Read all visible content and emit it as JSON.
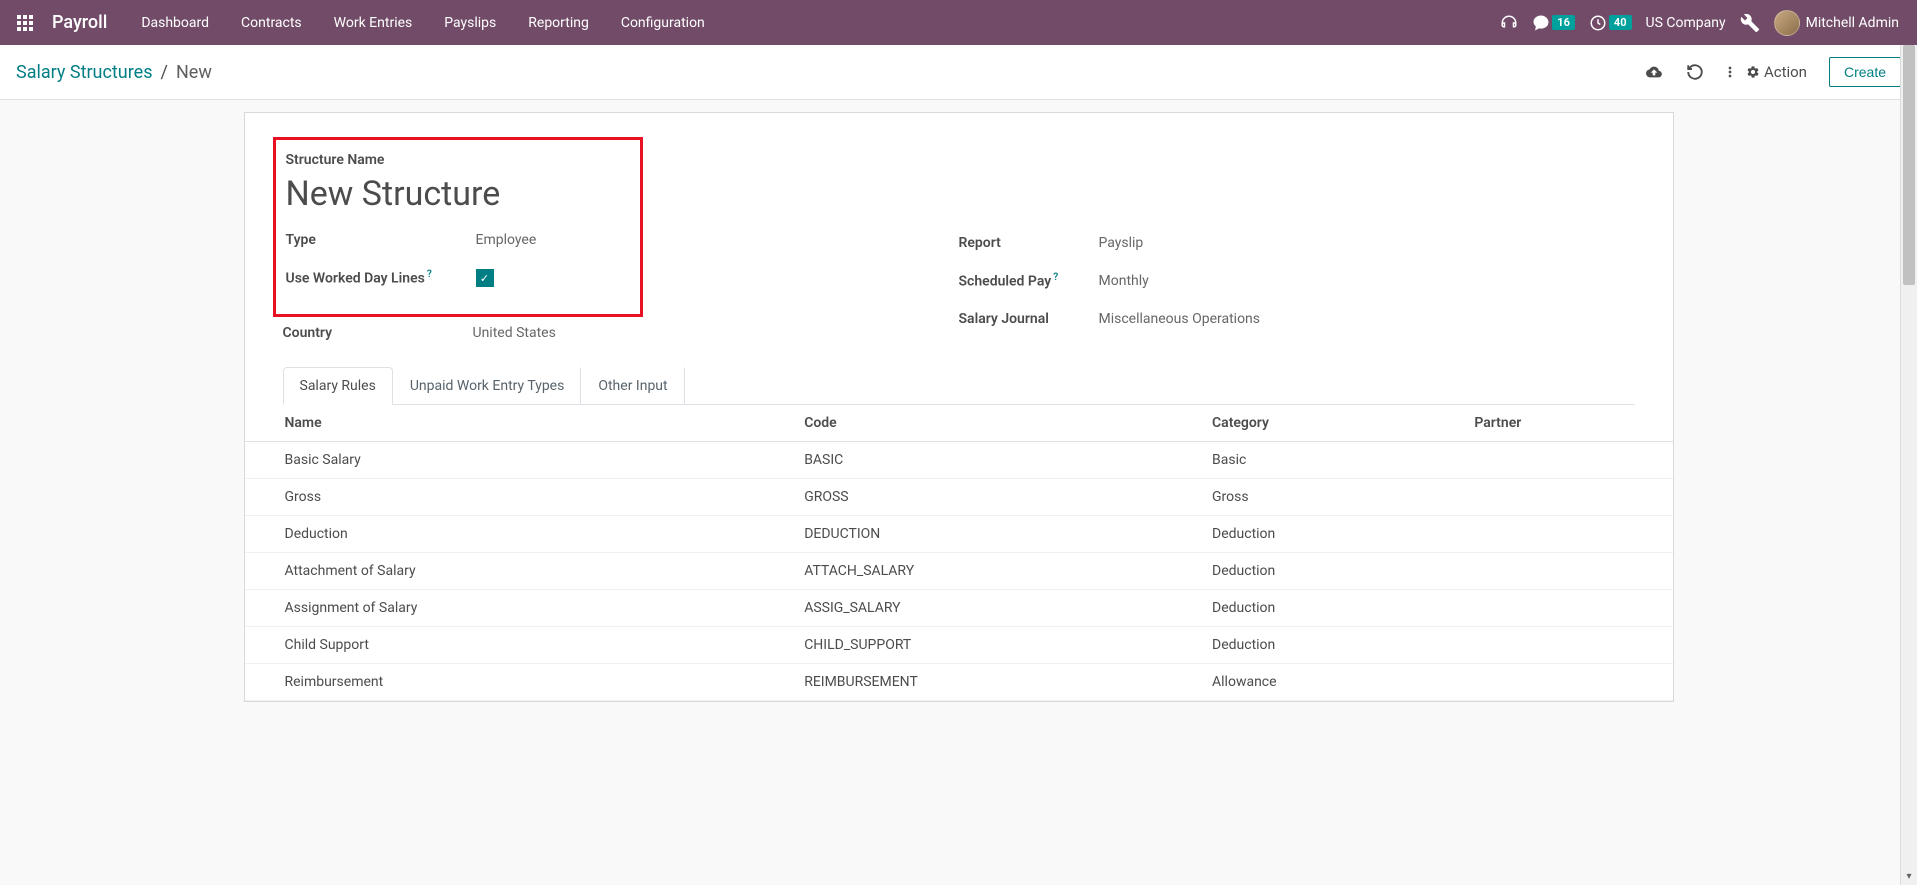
{
  "topbar": {
    "app_title": "Payroll",
    "nav": [
      "Dashboard",
      "Contracts",
      "Work Entries",
      "Payslips",
      "Reporting",
      "Configuration"
    ],
    "messages_badge": "16",
    "activities_badge": "40",
    "company": "US Company",
    "username": "Mitchell Admin"
  },
  "controlbar": {
    "breadcrumb_parent": "Salary Structures",
    "breadcrumb_current": "New",
    "action_label": "Action",
    "create_label": "Create"
  },
  "form": {
    "struct_name_label": "Structure Name",
    "struct_name_value": "New Structure",
    "type_label": "Type",
    "type_value": "Employee",
    "worked_day_label": "Use Worked Day Lines",
    "worked_day_checked": true,
    "country_label": "Country",
    "country_value": "United States",
    "report_label": "Report",
    "report_value": "Payslip",
    "scheduled_pay_label": "Scheduled Pay",
    "scheduled_pay_value": "Monthly",
    "salary_journal_label": "Salary Journal",
    "salary_journal_value": "Miscellaneous Operations"
  },
  "tabs": {
    "salary_rules": "Salary Rules",
    "unpaid": "Unpaid Work Entry Types",
    "other": "Other Input"
  },
  "table": {
    "headers": {
      "name": "Name",
      "code": "Code",
      "category": "Category",
      "partner": "Partner"
    },
    "rows": [
      {
        "name": "Basic Salary",
        "code": "BASIC",
        "category": "Basic",
        "partner": ""
      },
      {
        "name": "Gross",
        "code": "GROSS",
        "category": "Gross",
        "partner": ""
      },
      {
        "name": "Deduction",
        "code": "DEDUCTION",
        "category": "Deduction",
        "partner": ""
      },
      {
        "name": "Attachment of Salary",
        "code": "ATTACH_SALARY",
        "category": "Deduction",
        "partner": ""
      },
      {
        "name": "Assignment of Salary",
        "code": "ASSIG_SALARY",
        "category": "Deduction",
        "partner": ""
      },
      {
        "name": "Child Support",
        "code": "CHILD_SUPPORT",
        "category": "Deduction",
        "partner": ""
      },
      {
        "name": "Reimbursement",
        "code": "REIMBURSEMENT",
        "category": "Allowance",
        "partner": ""
      }
    ]
  }
}
